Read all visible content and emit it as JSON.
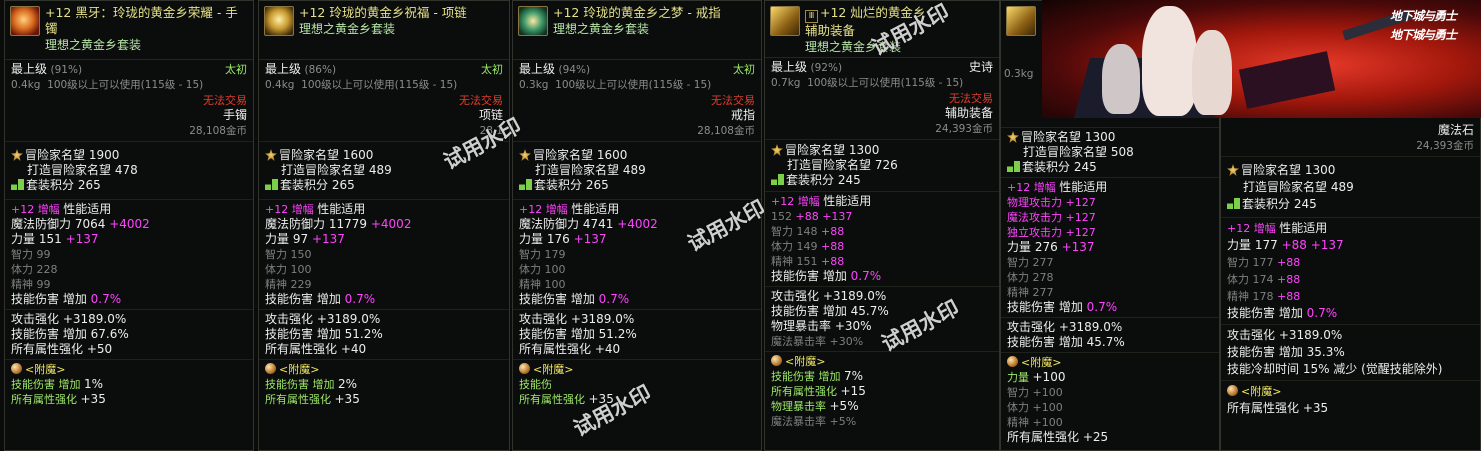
{
  "p1": {
    "title": "+12 黑牙：玲珑的黄金乡荣耀 - 手镯",
    "set": "理想之黄金乡套装",
    "grade": "最上级",
    "grade_pct": "(91%)",
    "rarity": "太初",
    "weight": "0.4kg",
    "use_req": "100级以上可以使用(115级 - 15)",
    "trade": "无法交易",
    "type": "手镯",
    "price": "28,108金币",
    "fame_label": "冒险家名望",
    "fame": "1900",
    "forge_label": "打造冒险家名望",
    "forge": "478",
    "setpt_label": "套装积分",
    "setpt": "265",
    "amp_label": "+12 增幅",
    "perf": "性能适用",
    "s1l": "魔法防御力",
    "s1v": "7064",
    "s1b": "+4002",
    "s2l": "力量",
    "s2v": "151",
    "s2b": "+137",
    "s3": "智力 99",
    "s4": "体力 228",
    "s5": "精神 99",
    "skill_l": "技能伤害 增加",
    "skill_v": "0.7%",
    "atk": "攻击强化 +3189.0%",
    "sk2": "技能伤害 增加 67.6%",
    "allel": "所有属性强化 +50",
    "ench_title": "<附魔>",
    "e1l": "技能伤害 增加",
    "e1v": "1%",
    "e2l": "所有属性强化",
    "e2v": "+35"
  },
  "p2": {
    "title": "+12 玲珑的黄金乡祝福 - 项链",
    "set": "理想之黄金乡套装",
    "grade": "最上级",
    "grade_pct": "(86%)",
    "rarity": "太初",
    "weight": "0.4kg",
    "use_req": "100级以上可以使用(115级 - 15)",
    "trade": "无法交易",
    "type": "项链",
    "price": "28,1",
    "fame_label": "冒险家名望",
    "fame": "1600",
    "forge_label": "打造冒险家名望",
    "forge": "489",
    "setpt_label": "套装积分",
    "setpt": "265",
    "amp_label": "+12 增幅",
    "perf": "性能适用",
    "s1l": "魔法防御力",
    "s1v": "11779",
    "s1b": "+4002",
    "s2l": "力量",
    "s2v": "97",
    "s2b": "+137",
    "s3": "智力 150",
    "s4": "体力 100",
    "s5": "精神 229",
    "skill_l": "技能伤害 增加",
    "skill_v": "0.7%",
    "atk": "攻击强化 +3189.0%",
    "sk2": "技能伤害 增加 51.2%",
    "allel": "所有属性强化 +40",
    "ench_title": "<附魔>",
    "e1l": "技能伤害 增加",
    "e1v": "2%",
    "e2l": "所有属性强化",
    "e2v": "+35"
  },
  "p3": {
    "title": "+12 玲珑的黄金乡之梦 - 戒指",
    "set": "理想之黄金乡套装",
    "grade": "最上级",
    "grade_pct": "(94%)",
    "rarity": "太初",
    "weight": "0.3kg",
    "use_req": "100级以上可以使用(115级 - 15)",
    "trade": "无法交易",
    "type": "戒指",
    "price": "28,108金币",
    "fame_label": "冒险家名望",
    "fame": "1600",
    "forge_label": "打造冒险家名望",
    "forge": "489",
    "setpt_label": "套装积分",
    "setpt": "265",
    "amp_label": "+12 增幅",
    "perf": "性能适用",
    "s1l": "魔法防御力",
    "s1v": "4741",
    "s1b": "+4002",
    "s2l": "力量",
    "s2v": "176",
    "s2b": "+137",
    "s3": "智力 179",
    "s4": "体力 100",
    "s5": "精神 100",
    "skill_l": "技能伤害 增加",
    "skill_v": "0.7%",
    "atk": "攻击强化 +3189.0%",
    "sk2": "技能伤害 增加 51.2%",
    "allel": "所有属性强化 +40",
    "ench_title": "<附魔>",
    "e1l": "技能伤",
    "e2l": "所有属性强化",
    "e2v": "+35"
  },
  "p4": {
    "title": "+12 灿烂的黄金乡",
    "title2": "辅助装备",
    "set": "理想之黄金乡套装",
    "grade": "最上级",
    "grade_pct": "(92%)",
    "rarity": "史诗",
    "weight": "0.7kg",
    "use_req": "100级以上可以使用(115级 - 15)",
    "trade": "无法交易",
    "type": "辅助装备",
    "price": "24,393金币",
    "fame_label": "冒险家名望",
    "fame": "1300",
    "forge_label": "打造冒险家名望",
    "forge": "726",
    "setpt_label": "套装积分",
    "setpt": "245",
    "amp_label": "+12 增幅",
    "perf": "性能适用",
    "s1": "152",
    "s1b": "+88",
    "s1c": "+137",
    "s2l": "智力 148",
    "s2b": "+88",
    "s3l": "体力 149",
    "s3b": "+88",
    "s4l": "精神 151",
    "s4b": "+88",
    "skill_l": "技能伤害 增加",
    "skill_v": "0.7%",
    "atk": "攻击强化 +3189.0%",
    "sk2": "技能伤害 增加 45.7%",
    "crit": "物理暴击率 +30%",
    "mcrit": "魔法暴击率 +30%",
    "ench_title": "<附魔>",
    "e1l": "技能伤害 增加",
    "e1v": "7%",
    "e2l": "所有属性强化",
    "e2v": "+15",
    "e3l": "物理暴击率",
    "e3v": "+5%",
    "e4l": "魔法暴击率",
    "e4v": "+5%"
  },
  "p5": {
    "weight": "0.3kg",
    "fame_label": "冒险家名望",
    "fame": "1300",
    "forge_label": "打造冒险家名望",
    "forge": "508",
    "setpt_label": "套装积分",
    "setpt": "245",
    "amp_label": "+12 增幅",
    "perf": "性能适用",
    "a1l": "物理攻击力",
    "a1v": "+127",
    "a2l": "魔法攻击力",
    "a2v": "+127",
    "a3l": "独立攻击力",
    "a3v": "+127",
    "s1l": "力量 276",
    "s1v": "+137",
    "s2": "智力 277",
    "s3": "体力 278",
    "s4": "精神 277",
    "skill_l": "技能伤害 增加",
    "skill_v": "0.7%",
    "atk": "攻击强化 +3189.0%",
    "sk2": "技能伤害 增加 45.7%",
    "ench_title": "<附魔>",
    "e1l": "力量",
    "e1v": "+100",
    "e2": "智力 +100",
    "e3": "体力 +100",
    "e4": "精神 +100",
    "e5l": "所有属性强化",
    "e5v": "+25"
  },
  "p6": {
    "type": "魔法石",
    "price": "24,393金币",
    "fame_label": "冒险家名望",
    "fame": "1300",
    "forge_label": "打造冒险家名望",
    "forge": "489",
    "setpt_label": "套装积分",
    "setpt": "245",
    "amp_label": "+12 增幅",
    "perf": "性能适用",
    "s1l": "力量",
    "s1v": "177",
    "s1b": "+88",
    "s1c": "+137",
    "s2l": "智力 177",
    "s2b": "+88",
    "s3l": "体力 174",
    "s3b": "+88",
    "s4l": "精神 178",
    "s4b": "+88",
    "skill_l": "技能伤害 增加",
    "skill_v": "0.7%",
    "atk": "攻击强化 +3189.0%",
    "sk2": "技能伤害 增加 35.3%",
    "cd": "技能冷却时间 15% 减少 (觉醒技能除外)",
    "ench_title": "<附魔>",
    "e1l": "所有属性强化",
    "e1v": "+35"
  },
  "banner": {
    "logo": "地下城与勇士",
    "logo2": "地下城与勇士"
  },
  "watermark": "试用水印"
}
